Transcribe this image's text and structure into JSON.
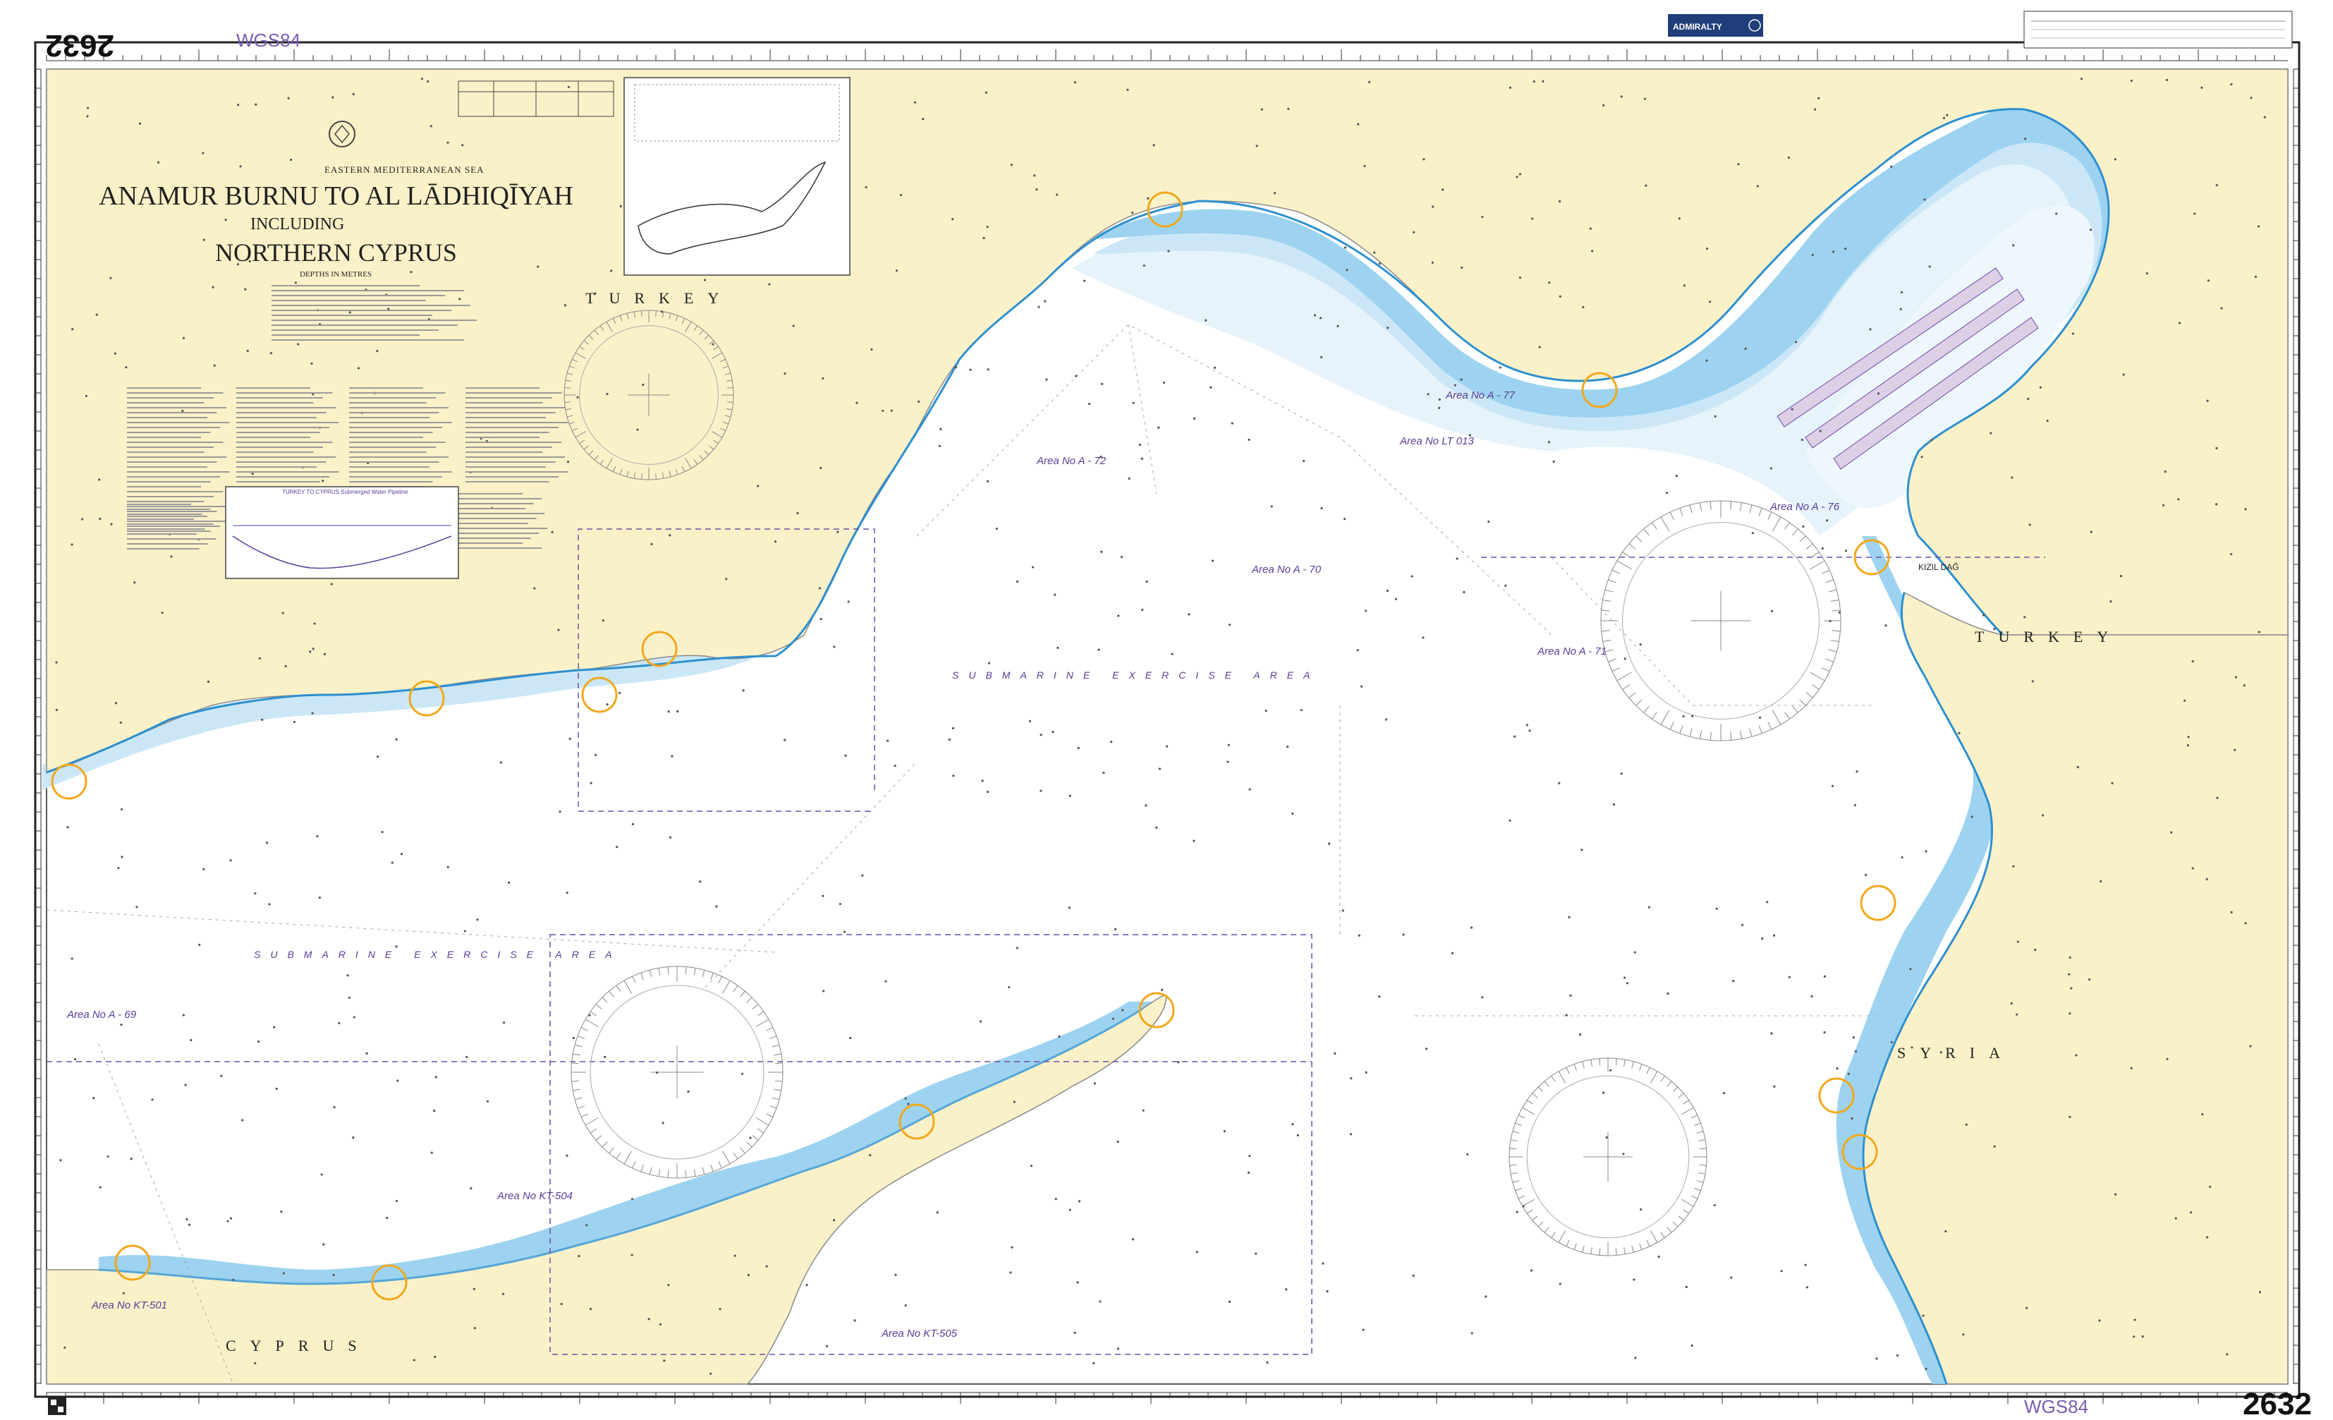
{
  "chart": {
    "number": "2632",
    "datum": "WGS84",
    "region": "EASTERN MEDITERRANEAN SEA",
    "title_line1": "ANAMUR BURNU TO AL LĀDHIQĪYAH",
    "title_line2": "INCLUDING",
    "title_line3": "NORTHERN CYPRUS",
    "depths_unit": "DEPTHS IN METRES",
    "publisher": "ADMIRALTY"
  },
  "countries": {
    "turkey_west": "TURKEY",
    "turkey_east": "TURKEY",
    "syria": "SYRIA",
    "cyprus": "CYPRUS"
  },
  "areas": {
    "sub_exercise_1": "SUBMARINE EXERCISE AREA",
    "sub_exercise_2": "SUBMARINE EXERCISE AREA",
    "a72": "Area No A - 72",
    "a70": "Area No A - 70",
    "a71": "Area No A - 71",
    "a77": "Area No A - 77",
    "lt013": "Area No LT 013",
    "a76": "Area No A - 76",
    "a69": "Area No A - 69",
    "kt504": "Area No KT-504",
    "kt505": "Area No KT-505",
    "kt501": "Area No KT-501"
  },
  "places": {
    "kizil_dag": "KIZIL DAĞ"
  },
  "inset": {
    "pipeline_title": "TURKEY TO CYPRUS Submerged Water Pipeline"
  },
  "colors": {
    "land": "#fbf1c9",
    "shallow_blue": "#9dd3f0",
    "mid_blue": "#cbe7f7",
    "pale_blue": "#e6f3fb",
    "sea": "#ffffff",
    "magenta": "#6f4aa8",
    "highlight": "#f2a81c"
  }
}
